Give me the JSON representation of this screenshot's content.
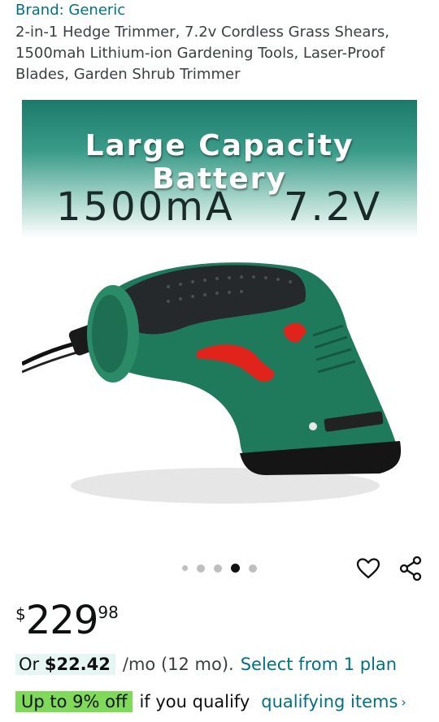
{
  "product": {
    "brand": "Brand: Generic",
    "title": "2-in-1 Hedge Trimmer, 7.2v Cordless Grass Shears, 1500mah Lithium-ion Gardening Tools, Laser-Proof Blades, Garden Shrub Trimmer"
  },
  "image": {
    "banner_line1": "Large Capacity Battery",
    "banner_capacity": "1500mA",
    "banner_voltage": "7.2V",
    "carousel_count": 5,
    "carousel_active_index": 3
  },
  "actions": {
    "wishlist_icon": "heart-icon",
    "share_icon": "share-icon"
  },
  "price": {
    "symbol": "$",
    "whole": "229",
    "fraction": "98"
  },
  "installment": {
    "prefix": "Or ",
    "amount": "$22.42",
    "suffix": "/mo (12 mo).",
    "link": "Select from 1 plan"
  },
  "offer": {
    "badge": "Up to 9% off",
    "text": "if you qualify",
    "link": "qualifying items"
  },
  "colors": {
    "link": "#007185",
    "offer_badge": "#7fda5a",
    "installment_bg": "#e6f6f3"
  }
}
